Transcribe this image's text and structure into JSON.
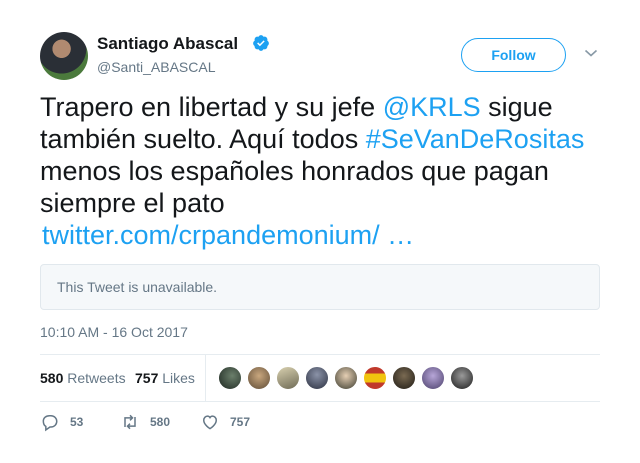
{
  "author": {
    "name": "Santiago Abascal",
    "handle": "@Santi_ABASCAL",
    "verified_icon": "verified-badge-icon"
  },
  "follow_label": "Follow",
  "tweet": {
    "part1": "Trapero en libertad y su jefe ",
    "mention": "@KRLS",
    "part2": " sigue también suelto. Aquí todos ",
    "hashtag": "#SeVanDeRositas",
    "part3": " menos los españoles honrados que pagan siempre el pato",
    "url": "twitter.com/crpandemonium/ …"
  },
  "quoted": {
    "text": "This Tweet is unavailable."
  },
  "timestamp": "10:10 AM - 16 Oct 2017",
  "stats": {
    "retweets_count": "580",
    "retweets_label": "Retweets",
    "likes_count": "757",
    "likes_label": "Likes"
  },
  "actions": {
    "replies": "53",
    "retweets": "580",
    "likes": "757"
  },
  "colors": {
    "accent": "#1da1f2",
    "muted": "#657786",
    "text": "#14171a"
  }
}
